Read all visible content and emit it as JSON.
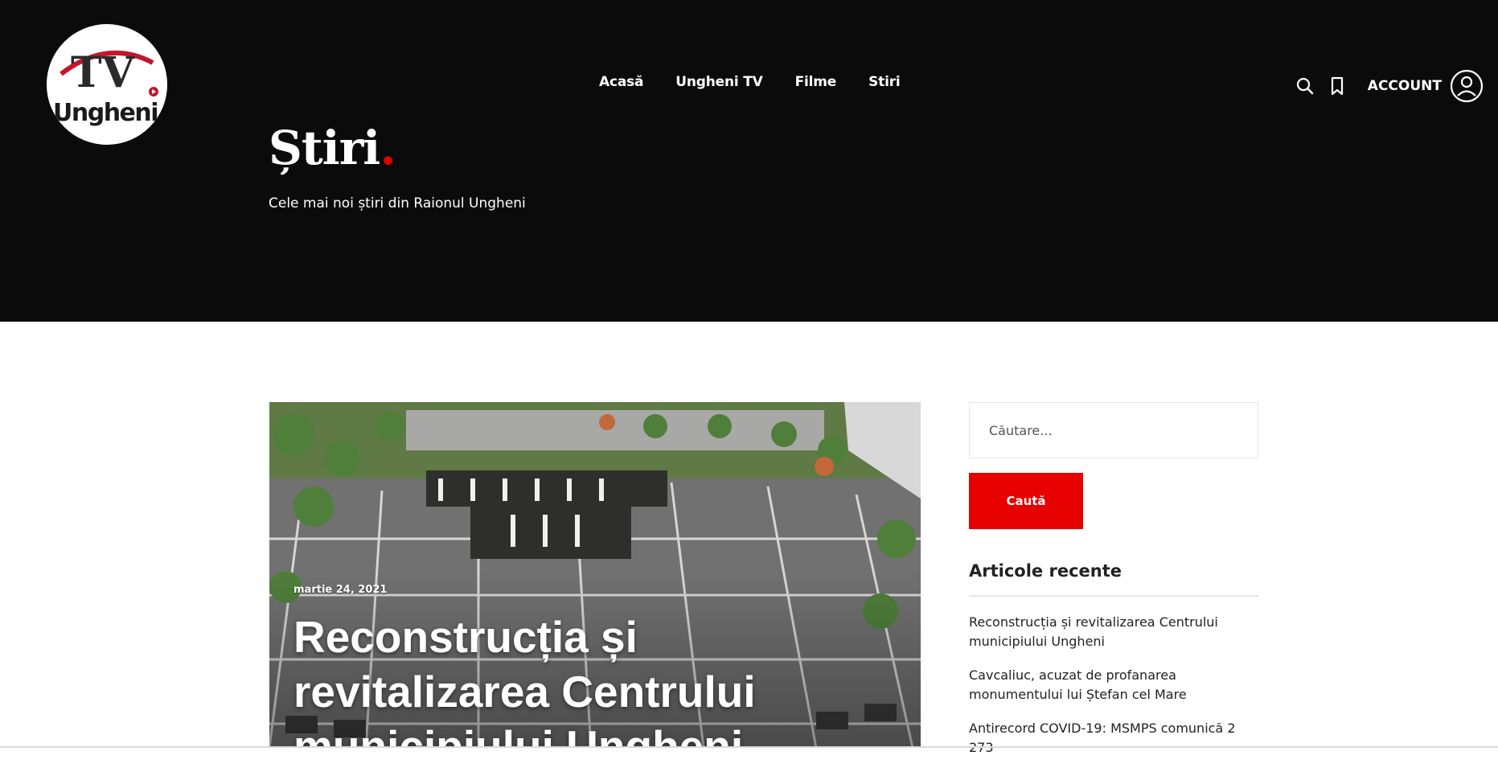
{
  "brand": {
    "logo_text_top": "TV",
    "logo_text_bottom": "Ungheni",
    "accent": "#e60000"
  },
  "nav": {
    "items": [
      "Acasă",
      "Ungheni TV",
      "Filme",
      "Stiri"
    ]
  },
  "header": {
    "account_label": "ACCOUNT",
    "icons": [
      "search-icon",
      "bookmark-icon",
      "user-circle-icon"
    ]
  },
  "page": {
    "title": "Știri",
    "title_dot": ".",
    "subtitle": "Cele mai noi știri din Raionul Ungheni"
  },
  "article": {
    "date": "martie 24, 2021",
    "title": "Reconstrucția și revitalizarea Centrului municipiului Ungheni"
  },
  "sidebar": {
    "search_placeholder": "Căutare...",
    "search_button": "Caută",
    "recent_heading": "Articole recente",
    "recent_items": [
      "Reconstrucția și revitalizarea Centrului municipiului Ungheni",
      "Cavcaliuc, acuzat de profanarea monumentului lui Ștefan cel Mare",
      "Antirecord COVID-19: MSMPS comunică 2 273"
    ]
  },
  "colors": {
    "hero_bg": "#0b0b0b",
    "text_white": "#ffffff",
    "button_red": "#e60000"
  }
}
